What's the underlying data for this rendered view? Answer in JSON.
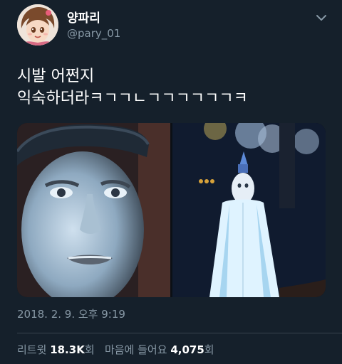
{
  "user": {
    "display_name": "양파리",
    "handle": "@pary_01"
  },
  "tweet": {
    "line1": "시발 어쩐지",
    "line2": "익숙하더라ㅋㄱㄱㄴㄱㄱㄱㄱㄱㄱㅋ"
  },
  "meta": {
    "timestamp": "2018. 2. 9. 오후 9:19"
  },
  "stats": {
    "retweet_label": "리트윗",
    "retweet_count": "18.3K",
    "retweet_suffix": "회",
    "like_label": "마음에 들어요",
    "like_count": "4,075",
    "like_suffix": "회"
  },
  "icons": {
    "menu": "chevron-down-icon"
  },
  "colors": {
    "background": "#15202b",
    "secondary_text": "#8899a6",
    "divider": "#38444d"
  }
}
